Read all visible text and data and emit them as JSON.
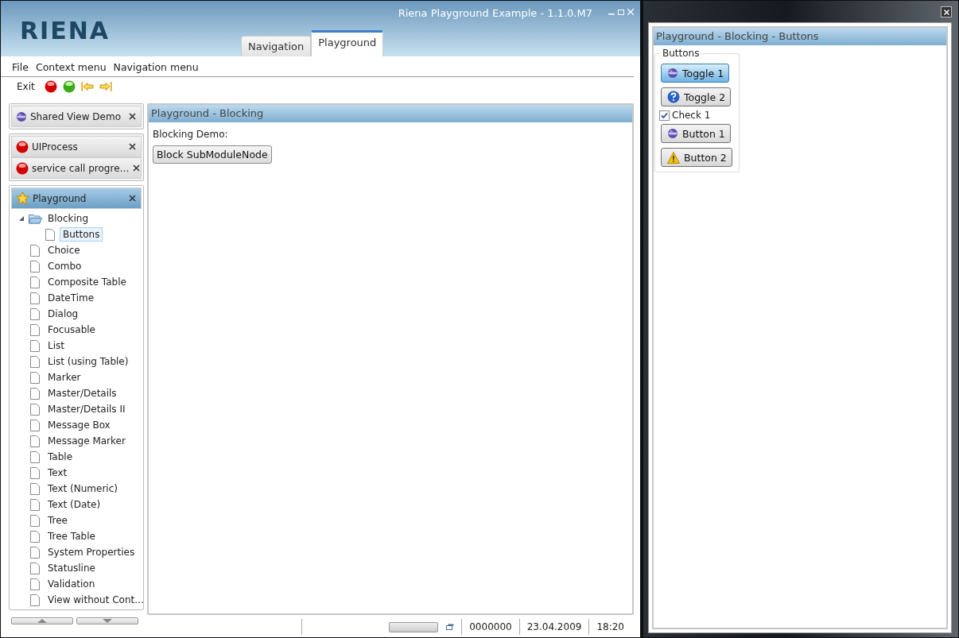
{
  "window": {
    "title": "Riena Playground Example - 1.1.0.M7"
  },
  "logo": "RIENA",
  "tabs": [
    {
      "label": "Navigation",
      "selected": false
    },
    {
      "label": "Playground",
      "selected": true
    }
  ],
  "menu": [
    "File",
    "Context menu",
    "Navigation menu"
  ],
  "toolbar": [
    {
      "kind": "text",
      "label": "Exit"
    },
    {
      "kind": "red-ball"
    },
    {
      "kind": "green-ball"
    },
    {
      "kind": "back"
    },
    {
      "kind": "forward"
    }
  ],
  "nav": {
    "groups": [
      {
        "modules": [
          {
            "label": "Shared View Demo",
            "kind": "globe",
            "selected": false
          }
        ]
      },
      {
        "modules": [
          {
            "label": "UIProcess",
            "kind": "process",
            "selected": false
          },
          {
            "label": "service call progre…",
            "kind": "process",
            "selected": false
          }
        ]
      },
      {
        "modules": [
          {
            "label": "Playground",
            "kind": "star",
            "selected": true,
            "tree": [
              {
                "label": "Blocking",
                "kind": "folder",
                "expanded": true,
                "selected": false,
                "children": [
                  {
                    "label": "Buttons",
                    "kind": "file",
                    "selected": true
                  }
                ]
              },
              {
                "label": "Choice",
                "kind": "file",
                "selected": false
              },
              {
                "label": "Combo",
                "kind": "file",
                "selected": false
              },
              {
                "label": "Composite Table",
                "kind": "file",
                "selected": false
              },
              {
                "label": "DateTime",
                "kind": "file",
                "selected": false
              },
              {
                "label": "Dialog",
                "kind": "file",
                "selected": false
              },
              {
                "label": "Focusable",
                "kind": "file",
                "selected": false
              },
              {
                "label": "List",
                "kind": "file",
                "selected": false
              },
              {
                "label": "List (using Table)",
                "kind": "file",
                "selected": false
              },
              {
                "label": "Marker",
                "kind": "file",
                "selected": false
              },
              {
                "label": "Master/Details",
                "kind": "file",
                "selected": false
              },
              {
                "label": "Master/Details II",
                "kind": "file",
                "selected": false
              },
              {
                "label": "Message Box",
                "kind": "file",
                "selected": false
              },
              {
                "label": "Message Marker",
                "kind": "file",
                "selected": false
              },
              {
                "label": "Table",
                "kind": "file",
                "selected": false
              },
              {
                "label": "Text",
                "kind": "file",
                "selected": false
              },
              {
                "label": "Text (Numeric)",
                "kind": "file",
                "selected": false
              },
              {
                "label": "Text (Date)",
                "kind": "file",
                "selected": false
              },
              {
                "label": "Tree",
                "kind": "file",
                "selected": false
              },
              {
                "label": "Tree Table",
                "kind": "file",
                "selected": false
              },
              {
                "label": "System Properties",
                "kind": "file",
                "selected": false
              },
              {
                "label": "Statusline",
                "kind": "file",
                "selected": false
              },
              {
                "label": "Validation",
                "kind": "file",
                "selected": false
              },
              {
                "label": "View without Cont...",
                "kind": "file",
                "selected": false
              }
            ]
          }
        ]
      }
    ]
  },
  "main_view": {
    "title": "Playground - Blocking",
    "label": "Blocking Demo:",
    "button": "Block SubModuleNode"
  },
  "status_bar": {
    "progress": {
      "level": 0
    },
    "number": "0000000",
    "date": "23.04.2009",
    "time": "18:20"
  },
  "detached_view": {
    "title": "Playground - Blocking - Buttons",
    "group": "Buttons",
    "controls": [
      {
        "kind": "toggle",
        "label": "Toggle 1",
        "selected": true
      },
      {
        "kind": "toggle",
        "label": "Toggle 2",
        "selected": false
      },
      {
        "kind": "checkbox",
        "label": "Check 1",
        "checked": true
      },
      {
        "kind": "button",
        "label": "Button 1"
      },
      {
        "kind": "button",
        "label": "Button 2"
      }
    ]
  }
}
